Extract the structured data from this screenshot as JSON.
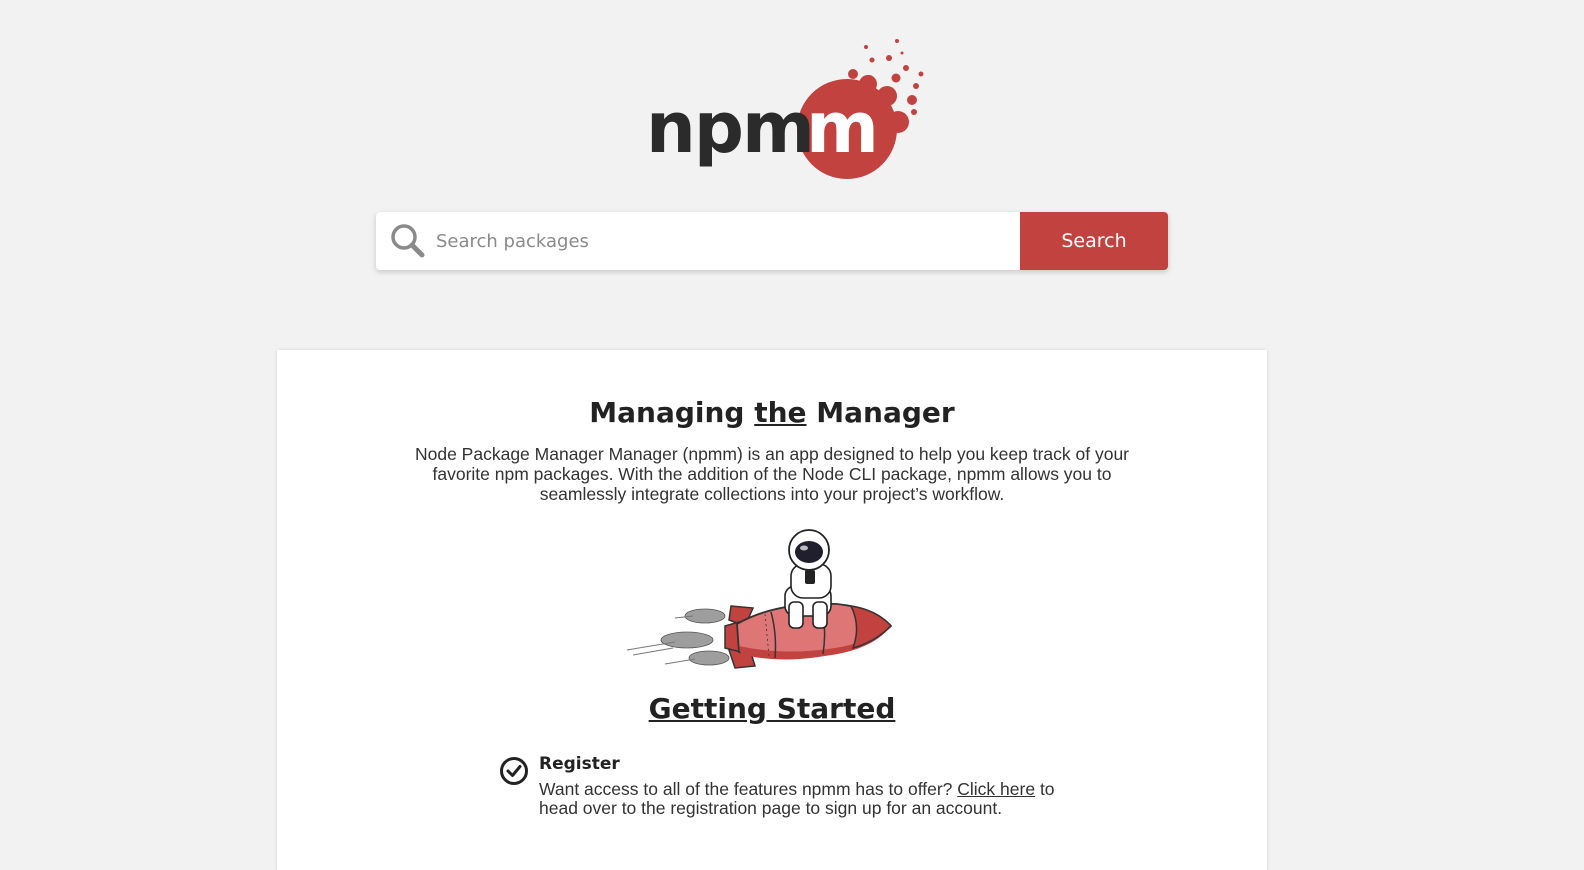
{
  "logo": {
    "text": "npmm",
    "accent_color": "#c24240",
    "text_color": "#2b2b2b"
  },
  "search": {
    "placeholder": "Search packages",
    "value": "",
    "button_label": "Search",
    "icon": "search-icon"
  },
  "hero": {
    "title_before": "Managing ",
    "title_emphasis": "the",
    "title_after": " Manager",
    "description": "Node Package Manager Manager (npmm) is an app designed to help you keep track of your favorite npm packages. With the addition of the Node CLI package, npmm allows you to seamlessly integrate collections into your project’s workflow.",
    "illustration": "astronaut-on-rocket"
  },
  "getting_started": {
    "title": "Getting Started",
    "steps": [
      {
        "icon": "check-circle-icon",
        "title": "Register",
        "text_before": "Want access to all of the features npmm has to offer? ",
        "link_text": "Click here",
        "text_after": " to head over to the registration page to sign up for an account."
      }
    ]
  },
  "colors": {
    "background": "#f2f2f2",
    "card": "#ffffff",
    "accent": "#c24240"
  }
}
